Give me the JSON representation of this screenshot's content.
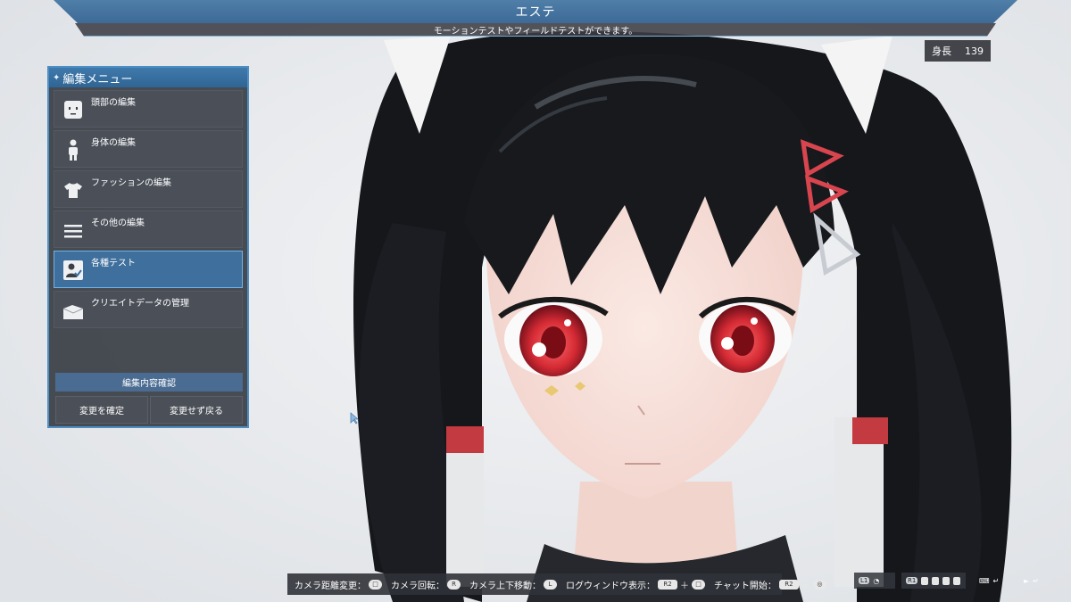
{
  "header": {
    "title": "エステ",
    "subtitle": "モーションテストやフィールドテストができます。"
  },
  "stats": {
    "height_label": "身長",
    "height_value": "139"
  },
  "menu": {
    "title": "編集メニュー",
    "items": [
      {
        "label": "頭部の編集",
        "icon": "head-icon",
        "selected": false
      },
      {
        "label": "身体の編集",
        "icon": "body-icon",
        "selected": false
      },
      {
        "label": "ファッションの編集",
        "icon": "shirt-icon",
        "selected": false
      },
      {
        "label": "その他の編集",
        "icon": "list-icon",
        "selected": false
      },
      {
        "label": "各種テスト",
        "icon": "test-icon",
        "selected": true
      },
      {
        "label": "クリエイトデータの管理",
        "icon": "folder-icon",
        "selected": false
      }
    ],
    "confirm_label": "編集内容確認",
    "apply_label": "変更を確定",
    "revert_label": "変更せず戻る"
  },
  "controls": [
    {
      "label": "カメラ距離変更：",
      "button": "□"
    },
    {
      "label": "カメラ回転：",
      "button": "R"
    },
    {
      "label": "カメラ上下移動：",
      "button": "L"
    },
    {
      "label": "ログウィンドウ表示：",
      "button": "R2",
      "plus": "＋",
      "button2": "□"
    },
    {
      "label": "チャット開始：",
      "button": "R2",
      "plus": "＋",
      "button2": "◎"
    }
  ],
  "tools": {
    "l1_tag": "L1",
    "r1_tag": "R1"
  },
  "colors": {
    "accent": "#3d6a96",
    "panel_border": "#4d8fc4",
    "selected": "#3f6f9c",
    "eye": "#d8323c",
    "hair": "#16181c"
  }
}
